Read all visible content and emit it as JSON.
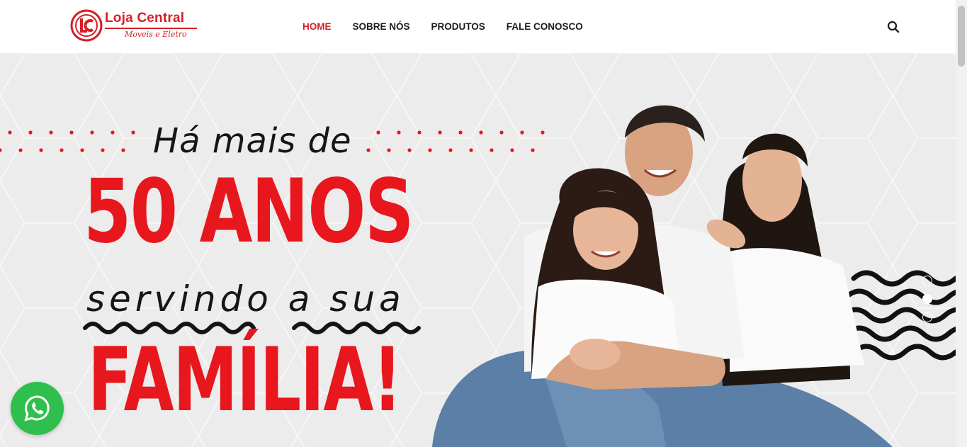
{
  "header": {
    "logo": {
      "name": "Loja Central",
      "tagline": "Moveis e Eletro",
      "icon": "lc-logo-mark"
    },
    "nav": [
      {
        "label": "HOME",
        "active": true
      },
      {
        "label": "SOBRE NÓS",
        "active": false
      },
      {
        "label": "PRODUTOS",
        "active": false
      },
      {
        "label": "FALE CONOSCO",
        "active": false
      }
    ],
    "search_icon": "search-icon"
  },
  "hero": {
    "line1": "Há mais de",
    "line2": "50 ANOS",
    "line3": "servindo a sua",
    "line4": "FAMÍLIA!",
    "slider": {
      "count": 3,
      "active_index": 1
    }
  },
  "whatsapp_icon": "whatsapp-icon",
  "colors": {
    "brand_red": "#e8161d",
    "nav_active": "#d61f26",
    "text_dark": "#161616",
    "whatsapp_green": "#2fbf4c",
    "hero_bg": "#ececec"
  }
}
